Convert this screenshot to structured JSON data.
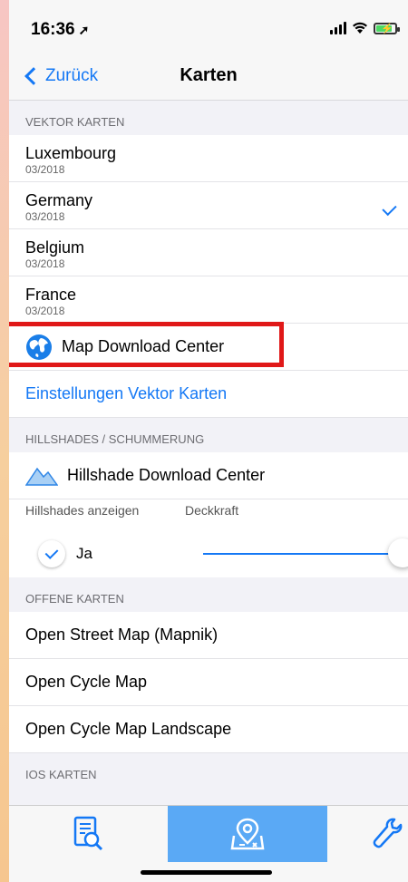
{
  "status": {
    "time": "16:36",
    "location_arrow": "➚"
  },
  "nav": {
    "back_label": "Zurück",
    "title": "Karten"
  },
  "vector": {
    "header": "VEKTOR KARTEN",
    "maps": [
      {
        "name": "Luxembourg",
        "date": "03/2018",
        "selected": false
      },
      {
        "name": "Germany",
        "date": "03/2018",
        "selected": true
      },
      {
        "name": "Belgium",
        "date": "03/2018",
        "selected": false
      },
      {
        "name": "France",
        "date": "03/2018",
        "selected": false
      }
    ],
    "download_center": "Map Download Center",
    "settings": "Einstellungen Vektor Karten"
  },
  "hillshades": {
    "header": "HILLSHADES / SCHUMMERUNG",
    "download_center": "Hillshade Download Center",
    "show_label": "Hillshades anzeigen",
    "opacity_label": "Deckkraft",
    "show_value": "Ja",
    "opacity_fraction": 1.0
  },
  "open_maps": {
    "header": "OFFENE KARTEN",
    "items": [
      "Open Street Map (Mapnik)",
      "Open Cycle Map",
      "Open Cycle Map Landscape"
    ]
  },
  "ios_maps": {
    "header": "IOS KARTEN"
  },
  "tabs": [
    {
      "icon": "document-search-icon",
      "active": false
    },
    {
      "icon": "map-pin-icon",
      "active": true
    },
    {
      "icon": "wrench-icon",
      "active": false
    }
  ],
  "colors": {
    "accent": "#1478f5",
    "highlight": "#e01818",
    "active_tab": "#5aa9f5"
  }
}
